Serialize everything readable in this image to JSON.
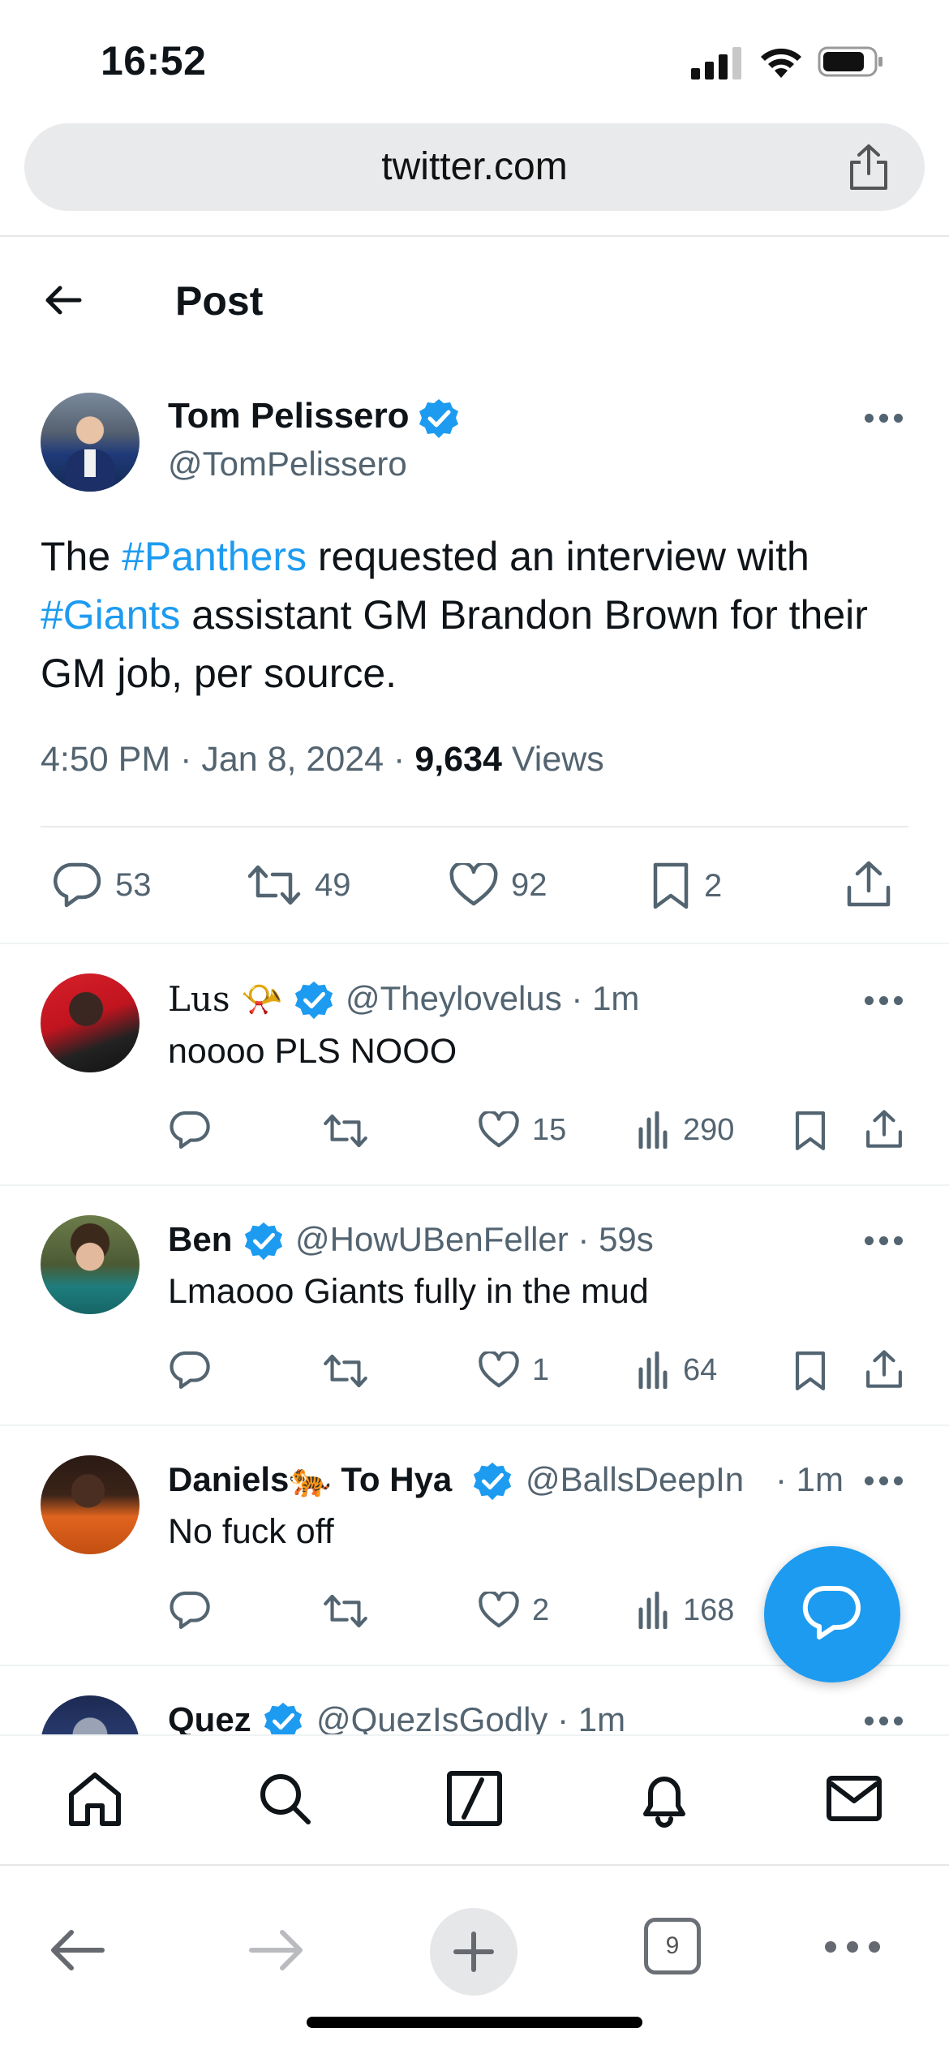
{
  "status_bar": {
    "time": "16:52"
  },
  "browser": {
    "url": "twitter.com",
    "open_tabs": "9"
  },
  "header": {
    "title": "Post"
  },
  "tweet": {
    "author_name": "Tom Pelissero",
    "author_handle": "@TomPelissero",
    "text_parts": [
      "The ",
      "#Panthers",
      " requested an interview with ",
      "#Giants",
      " assistant GM Brandon Brown for their GM job, per source."
    ],
    "time": "4:50 PM · Jan 8, 2024 · ",
    "views_count": "9,634",
    "views_label": " Views",
    "replies": "53",
    "reposts": "49",
    "likes": "92",
    "bookmarks": "2"
  },
  "replies": [
    {
      "name": "Lus",
      "name_emoji": "📯",
      "handle": "@Theylovelus · 1m",
      "text": "noooo PLS NOOO",
      "likes": "15",
      "views": "290"
    },
    {
      "name": "Ben",
      "handle": "@HowUBenFeller · 59s",
      "text": "Lmaooo Giants fully in the mud",
      "likes": "1",
      "views": "64"
    },
    {
      "name": "Daniels",
      "name_emoji": "🐅",
      "name_suffix": " To Hya",
      "handle": "@BallsDeepIn",
      "time": "· 1m",
      "text": "No fuck off",
      "likes": "2",
      "views": "168"
    },
    {
      "name": "Quez",
      "handle": "@QuezIsGodly · 1m"
    }
  ],
  "colors": {
    "accent": "#1d9bf0",
    "secondary_text": "#536471",
    "primary_text": "#0f1419"
  },
  "icons": {
    "tabbar": [
      "home-icon",
      "search-icon",
      "compose-icon",
      "bell-icon",
      "mail-icon"
    ],
    "browser": [
      "back-icon",
      "forward-icon",
      "plus-icon",
      "tabs-icon",
      "more-icon"
    ]
  }
}
